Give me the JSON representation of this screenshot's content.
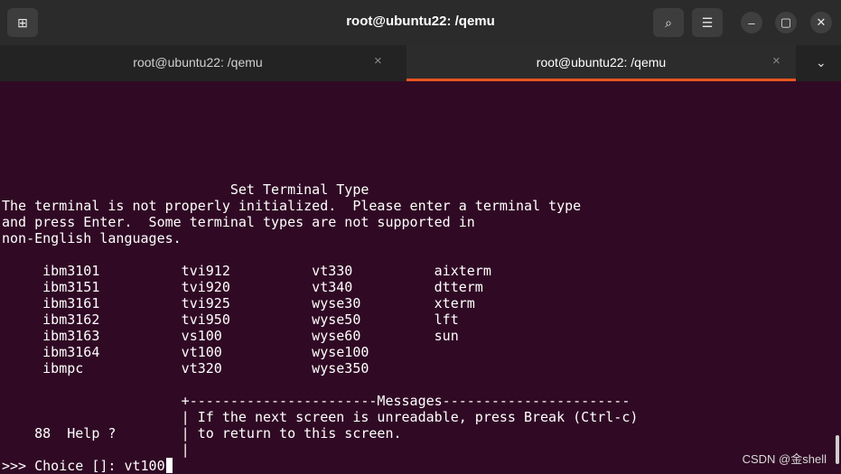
{
  "window": {
    "title": "root@ubuntu22: /qemu"
  },
  "tabs": [
    {
      "label": "root@ubuntu22: /qemu",
      "close": "×"
    },
    {
      "label": "root@ubuntu22: /qemu",
      "close": "×"
    }
  ],
  "icons": {
    "new_tab": "⊞",
    "search": "⌕",
    "menu": "☰",
    "minimize": "–",
    "maximize": "▢",
    "close": "✕",
    "tab_menu": "⌄"
  },
  "terminal": {
    "lines": [
      "                            Set Terminal Type",
      "The terminal is not properly initialized.  Please enter a terminal type",
      "and press Enter.  Some terminal types are not supported in",
      "non-English languages.",
      "",
      "     ibm3101          tvi912          vt330          aixterm",
      "     ibm3151          tvi920          vt340          dtterm",
      "     ibm3161          tvi925          wyse30         xterm",
      "     ibm3162          tvi950          wyse50         lft",
      "     ibm3163          vs100           wyse60         sun",
      "     ibm3164          vt100           wyse100",
      "     ibmpc            vt320           wyse350",
      "",
      "                      +-----------------------Messages-----------------------",
      "                      | If the next screen is unreadable, press Break (Ctrl-c)",
      "    88  Help ?        | to return to this screen.",
      "                      |"
    ],
    "prompt": ">>> Choice []: vt100"
  },
  "watermark": "CSDN @金shell",
  "colors": {
    "background": "#300a24",
    "accent": "#e95420",
    "text": "#ffffff"
  }
}
